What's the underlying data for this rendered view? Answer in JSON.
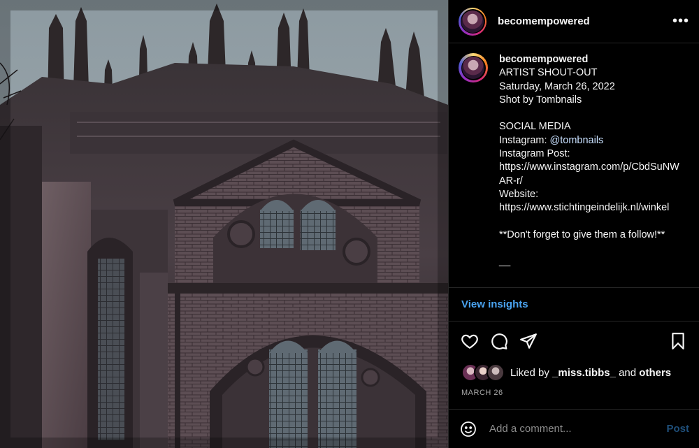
{
  "post": {
    "image_alt": "Gothic cathedral facade photographed from below",
    "username": "becomempowered",
    "more_icon": "more-horizontal-icon"
  },
  "caption": {
    "username": "becomempowered",
    "lines": [
      "ARTIST SHOUT-OUT",
      "Saturday, March 26, 2022",
      "Shot by Tombnails",
      "",
      "SOCIAL MEDIA",
      "Instagram: ",
      "Instagram Post:",
      "https://www.instagram.com/p/CbdSuNWAR-r/",
      "Website:",
      "https://www.stichtingeindelijk.nl/winkel",
      "",
      "**Don't forget to give them a follow!**",
      "",
      "__"
    ],
    "mention": "@tombnails"
  },
  "insights_label": "View insights",
  "actions": {
    "like_icon": "heart-icon",
    "comment_icon": "comment-icon",
    "share_icon": "send-icon",
    "save_icon": "bookmark-icon"
  },
  "likes": {
    "prefix": "Liked by ",
    "user": "_miss.tibbs_",
    "joiner": " and ",
    "others": "others"
  },
  "date": "MARCH 26",
  "comment": {
    "placeholder": "Add a comment...",
    "post_label": "Post"
  }
}
